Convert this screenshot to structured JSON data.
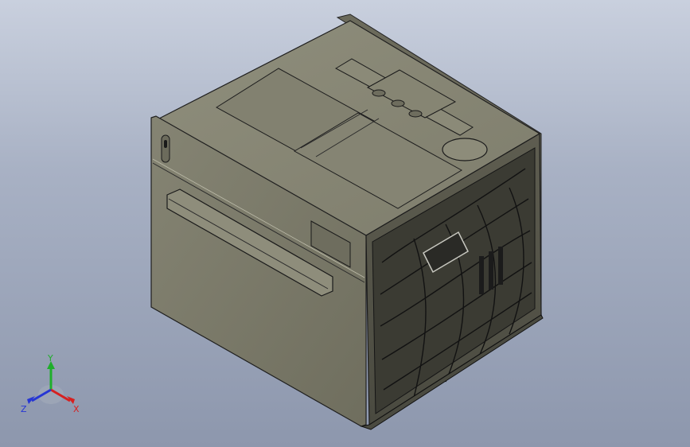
{
  "viewport": {
    "background_top": "#c9d0de",
    "background_bottom": "#8d97ad"
  },
  "model": {
    "body_color": "#7c7b6a",
    "front_panel_color": "#7b7a69",
    "top_color": "#8a8977",
    "edge_color": "#1f1f1f",
    "grille_color": "#2f2f2f"
  },
  "triad": {
    "x_label": "X",
    "y_label": "Y",
    "z_label": "Z",
    "x_color": "#d62020",
    "y_color": "#1fae2b",
    "z_color": "#2636d4"
  }
}
